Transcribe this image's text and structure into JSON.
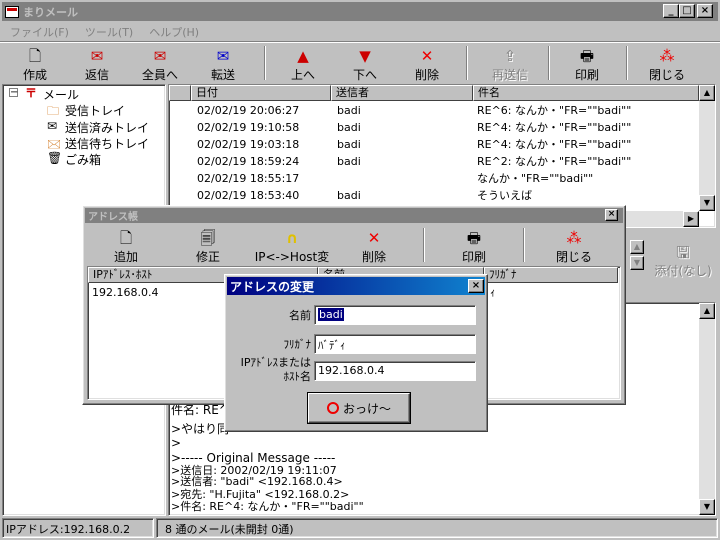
{
  "window": {
    "title": "まりメール"
  },
  "menu": [
    "ファイル(F)",
    "ツール(T)",
    "ヘルプ(H)"
  ],
  "toolbar": [
    {
      "label": "作成",
      "icon": "new-mail-icon",
      "enabled": true
    },
    {
      "label": "返信",
      "icon": "reply-icon",
      "enabled": true
    },
    {
      "label": "全員へ",
      "icon": "reply-all-icon",
      "enabled": true
    },
    {
      "label": "転送",
      "icon": "forward-icon",
      "enabled": true
    },
    {
      "label": "上へ",
      "icon": "arrow-up-icon",
      "enabled": true
    },
    {
      "label": "下へ",
      "icon": "arrow-down-icon",
      "enabled": true
    },
    {
      "label": "削除",
      "icon": "delete-icon",
      "enabled": true
    },
    {
      "label": "再送信",
      "icon": "resend-icon",
      "enabled": false
    },
    {
      "label": "印刷",
      "icon": "print-icon",
      "enabled": true
    },
    {
      "label": "閉じる",
      "icon": "close-app-icon",
      "enabled": true
    }
  ],
  "tree": {
    "root": "メール",
    "items": [
      "受信トレイ",
      "送信済みトレイ",
      "送信待ちトレイ",
      "ごみ箱"
    ]
  },
  "list": {
    "columns": [
      "日付",
      "送信者",
      "件名"
    ],
    "rows": [
      [
        "02/02/19 20:06:27",
        "badi",
        "RE^6: なんか・\"FR=\"\"badi\"\""
      ],
      [
        "02/02/19 19:10:58",
        "badi",
        "RE^4: なんか・\"FR=\"\"badi\"\""
      ],
      [
        "02/02/19 19:03:18",
        "badi",
        "RE^4: なんか・\"FR=\"\"badi\"\""
      ],
      [
        "02/02/19 18:59:24",
        "badi",
        "RE^2: なんか・\"FR=\"\"badi\"\""
      ],
      [
        "02/02/19 18:55:17",
        "",
        "なんか・\"FR=\"\"badi\"\""
      ],
      [
        "02/02/19 18:53:40",
        "badi",
        "そういえば"
      ]
    ]
  },
  "attach": {
    "label": "添付(なし)"
  },
  "preview": {
    "lines": [
      "件名: RE^",
      ">やはり同",
      ">",
      ">----- Original Message -----",
      ">送信日: 2002/02/19 19:11:07",
      ">送信者: \"badi\" <192.168.0.4>",
      ">宛先: \"H.Fujita\" <192.168.0.2>",
      ">件名: RE^4: なんか・\"FR=\"\"badi\"\""
    ]
  },
  "status": {
    "left": "IPアドレス:192.168.0.2",
    "right": "8 通のメール(未開封 0通)"
  },
  "addressbook": {
    "title": "アドレス帳",
    "toolbar": [
      {
        "label": "追加",
        "icon": "add-icon"
      },
      {
        "label": "修正",
        "icon": "edit-icon"
      },
      {
        "label": "IP<->Host変換",
        "icon": "convert-icon"
      },
      {
        "label": "削除",
        "icon": "delete-icon"
      },
      {
        "label": "印刷",
        "icon": "print-icon"
      },
      {
        "label": "閉じる",
        "icon": "close-app-icon"
      }
    ],
    "columns": [
      "IPｱﾄﾞﾚｽ･ﾎｽﾄ",
      "名前",
      "ﾌﾘｶﾞﾅ"
    ],
    "rows": [
      [
        "192.168.0.4",
        "",
        "ｨ"
      ]
    ]
  },
  "dialog": {
    "title": "アドレスの変更",
    "name_label": "名前",
    "name_value": "badi",
    "kana_label": "ﾌﾘｶﾞﾅ",
    "kana_value": "ﾊﾞﾃﾞｨ",
    "host_label_1": "IPｱﾄﾞﾚｽまたは",
    "host_label_2": "ﾎｽﾄ名",
    "host_value": "192.168.0.4",
    "ok_label": "おっけ～"
  }
}
